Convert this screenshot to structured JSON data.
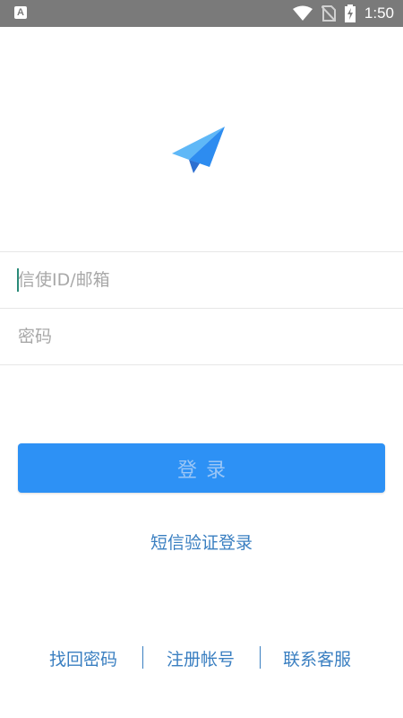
{
  "status_bar": {
    "time": "1:50",
    "app_badge": "A",
    "icons": [
      "wifi-icon",
      "no-sim-icon",
      "battery-charging-icon"
    ]
  },
  "logo": {
    "icon": "paper-plane-icon",
    "colors": [
      "#2d8cf0",
      "#5fb8f7"
    ]
  },
  "form": {
    "id_placeholder": "信使ID/邮箱",
    "password_placeholder": "密码"
  },
  "login_button": {
    "label": "登录",
    "color": "#2d91f5"
  },
  "sms_login_label": "短信验证登录",
  "footer": {
    "find_password": "找回密码",
    "register": "注册帐号",
    "contact_service": "联系客服"
  },
  "colors": {
    "link": "#3a7fc1",
    "caret": "#2a8a78"
  }
}
